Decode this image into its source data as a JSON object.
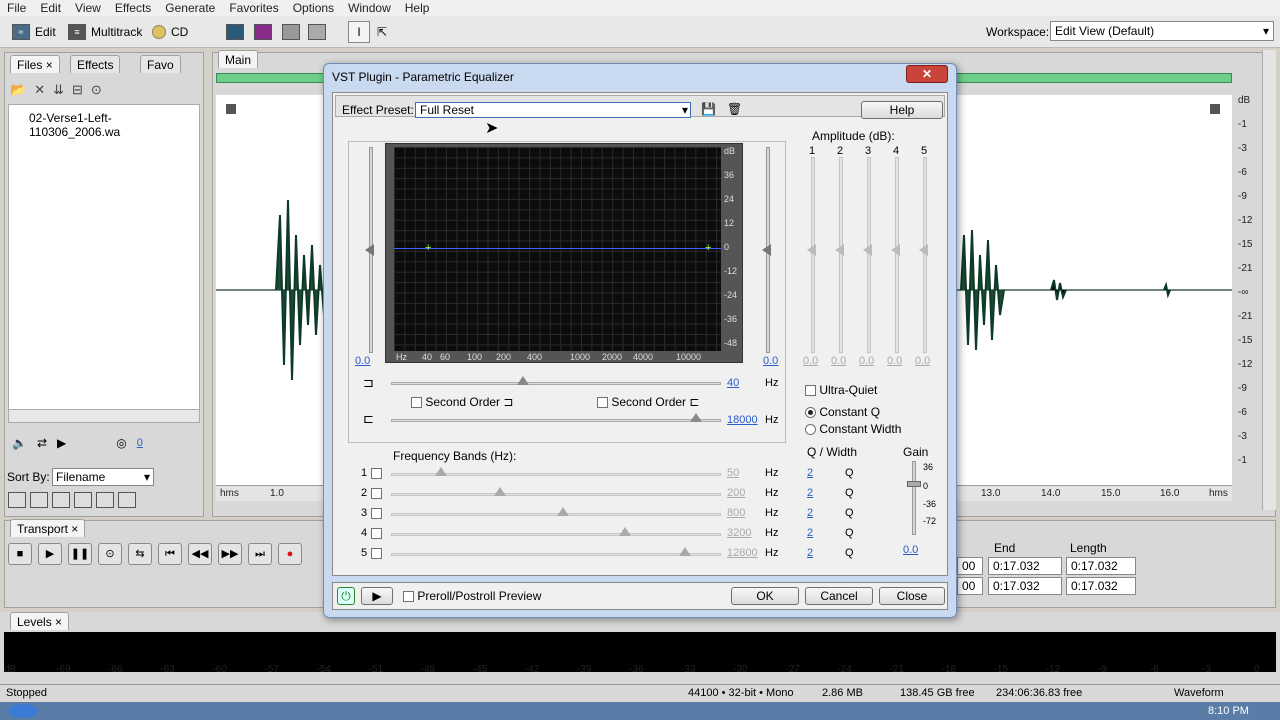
{
  "menu": [
    "File",
    "Edit",
    "View",
    "Effects",
    "Generate",
    "Favorites",
    "Options",
    "Window",
    "Help"
  ],
  "toolbar": {
    "edit_label": "Edit",
    "multitrack_label": "Multitrack",
    "cd_label": "CD",
    "workspace_label": "Workspace:",
    "workspace_value": "Edit View (Default)"
  },
  "left_panel": {
    "tabs": [
      "Files",
      "Effects",
      "Favo"
    ],
    "file_name": "02-Verse1-Left-110306_2006.wa",
    "sort_label": "Sort By:",
    "sort_value": "Filename",
    "vol_value": "0"
  },
  "main": {
    "tab": "Main",
    "ruler_left": [
      "hms",
      "1.0"
    ],
    "ruler_right": [
      "13.0",
      "14.0",
      "15.0",
      "16.0",
      "hms"
    ],
    "db_scale": [
      "dB",
      "-1",
      "-3",
      "-6",
      "-9",
      "-12",
      "-15",
      "-21",
      "-∞",
      "-21",
      "-15",
      "-12",
      "-9",
      "-6",
      "-3",
      "-1"
    ]
  },
  "dialog": {
    "title": "VST Plugin - Parametric Equalizer",
    "close": "✕",
    "preset_label": "Effect Preset:",
    "preset_value": "Full Reset",
    "help": "Help",
    "amplitude_label": "Amplitude (dB):",
    "amp_cols": [
      "1",
      "2",
      "3",
      "4",
      "5"
    ],
    "amp_values": [
      "0.0",
      "0.0",
      "0.0",
      "0.0",
      "0.0"
    ],
    "left_gain": "0.0",
    "right_gain": "0.0",
    "graph_db": [
      "dB",
      "36",
      "24",
      "12",
      "0",
      "-12",
      "-24",
      "-36",
      "-48"
    ],
    "graph_hz": [
      "Hz",
      "40",
      "60",
      "100",
      "200",
      "400",
      "1000",
      "2000",
      "4000",
      "10000"
    ],
    "low_freq": "40",
    "high_freq": "18000",
    "hz": "Hz",
    "second_order": "Second Order",
    "ultra_quiet": "Ultra-Quiet",
    "constant_q": "Constant Q",
    "constant_width": "Constant Width",
    "freq_bands_label": "Frequency Bands (Hz):",
    "q_width_label": "Q / Width",
    "gain_label": "Gain",
    "bands": [
      {
        "n": "1",
        "freq": "50",
        "q": "2",
        "qlabel": "Q",
        "pos": 0.15
      },
      {
        "n": "2",
        "freq": "200",
        "q": "2",
        "qlabel": "Q",
        "pos": 0.33
      },
      {
        "n": "3",
        "freq": "800",
        "q": "2",
        "qlabel": "Q",
        "pos": 0.52
      },
      {
        "n": "4",
        "freq": "3200",
        "q": "2",
        "qlabel": "Q",
        "pos": 0.71
      },
      {
        "n": "5",
        "freq": "12800",
        "q": "2",
        "qlabel": "Q",
        "pos": 0.89
      }
    ],
    "gain_scale": [
      "36",
      "0",
      "-36",
      "-72"
    ],
    "gain_value": "0.0",
    "preroll": "Preroll/Postroll Preview",
    "ok": "OK",
    "cancel": "Cancel",
    "close_btn": "Close"
  },
  "transport": {
    "tab": "Transport",
    "end_label": "End",
    "length_label": "Length",
    "begin_partial": [
      "00",
      "00"
    ],
    "end": [
      "0:17.032",
      "0:17.032"
    ],
    "length": [
      "0:17.032",
      "0:17.032"
    ]
  },
  "levels": {
    "tab": "Levels",
    "scale": [
      "dB",
      "-69",
      "-66",
      "-63",
      "-60",
      "-57",
      "-54",
      "-51",
      "-48",
      "-45",
      "-42",
      "-39",
      "-36",
      "-33",
      "-30",
      "-27",
      "-24",
      "-21",
      "-18",
      "-15",
      "-12",
      "-9",
      "-6",
      "-3",
      "0"
    ]
  },
  "status": {
    "state": "Stopped",
    "format": "44100 • 32-bit • Mono",
    "size": "2.86 MB",
    "free": "138.45 GB free",
    "time_free": "234:06:36.83 free",
    "view": "Waveform"
  },
  "taskbar": {
    "clock": "8:10 PM"
  }
}
